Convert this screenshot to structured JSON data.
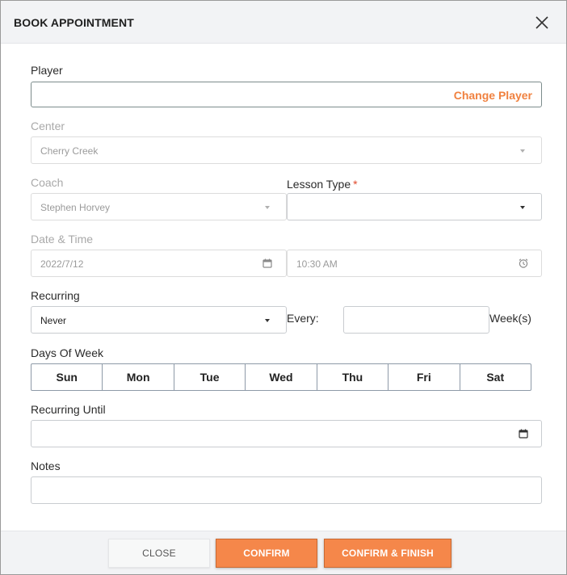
{
  "modal": {
    "title": "BOOK APPOINTMENT"
  },
  "player": {
    "label": "Player",
    "value": "",
    "change_label": "Change Player"
  },
  "center": {
    "label": "Center",
    "value": "Cherry Creek"
  },
  "coach": {
    "label": "Coach",
    "value": "Stephen Horvey"
  },
  "lesson_type": {
    "label": "Lesson Type",
    "required_mark": "*",
    "value": ""
  },
  "datetime": {
    "label": "Date & Time",
    "date": "2022/7/12",
    "time": "10:30 AM"
  },
  "recurring": {
    "label": "Recurring",
    "value": "Never",
    "every_label": "Every:",
    "every_value": "",
    "weeks_label": "Week(s)"
  },
  "days_of_week": {
    "label": "Days Of Week",
    "days": [
      "Sun",
      "Mon",
      "Tue",
      "Wed",
      "Thu",
      "Fri",
      "Sat"
    ]
  },
  "recurring_until": {
    "label": "Recurring Until",
    "value": ""
  },
  "notes": {
    "label": "Notes",
    "value": ""
  },
  "footer": {
    "close_label": "CLOSE",
    "confirm_label": "CONFIRM",
    "confirm_finish_label": "CONFIRM & FINISH"
  },
  "colors": {
    "accent": "#f5874a",
    "link": "#f0813f",
    "required": "#e0492b",
    "header_bg": "#f2f3f5"
  },
  "icons": {
    "close": "close-icon",
    "dropdown": "chevron-down-icon",
    "calendar": "calendar-icon",
    "clock": "alarm-clock-icon"
  }
}
